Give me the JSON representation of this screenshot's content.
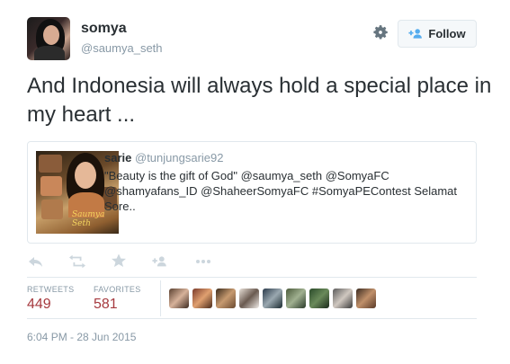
{
  "user": {
    "display_name": "somya",
    "handle": "@saumya_seth"
  },
  "header": {
    "follow_label": "Follow"
  },
  "tweet": {
    "text": "And Indonesia will always hold a special place in my heart ..."
  },
  "quoted": {
    "name": "sarie",
    "handle": "@tunjungsarie92",
    "text": "\"Beauty is the gift of God\" @saumya_seth @SomyaFC @shamyafans_ID @ShaheerSomyaFC #SomyaPEContest Selamat Sore..",
    "image_caption": "Saumya Seth"
  },
  "actions": [
    "reply-icon",
    "retweet-icon",
    "favorite-icon",
    "follow-icon",
    "more-icon"
  ],
  "stats": {
    "retweets_label": "RETWEETS",
    "retweets_value": "449",
    "favorites_label": "FAVORITES",
    "favorites_value": "581"
  },
  "favoriters_count": 9,
  "timestamp": "6:04 PM - 28 Jun 2015",
  "colors": {
    "stat_value": "#a63a3f",
    "muted": "#8899a6",
    "border": "#e1e8ed"
  }
}
